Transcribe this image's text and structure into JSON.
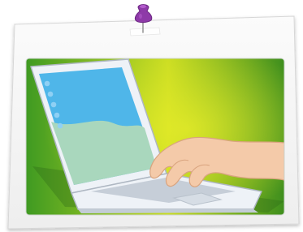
{
  "card": {
    "frame_color": "#f4f4f4",
    "frame_border_color": "#d7d7d7"
  },
  "pin": {
    "icon": "push-pin-icon",
    "head_color": "#8e3aa8",
    "needle_color": "#9a9a9a"
  },
  "background": {
    "gradient_colors": [
      "#3f9a22",
      "#c9dc22",
      "#3f8f1e"
    ]
  },
  "laptop": {
    "icon": "laptop-illustration",
    "body_color": "#eef2f7",
    "keyboard_color": "#c6ced8",
    "screen_sky_color": "#4fb6e9",
    "screen_hill_color": "#a9d7bd",
    "screen_icons_color": "#8fd0f4"
  },
  "hand": {
    "icon": "hand-illustration",
    "skin_color": "#f4caa9"
  }
}
